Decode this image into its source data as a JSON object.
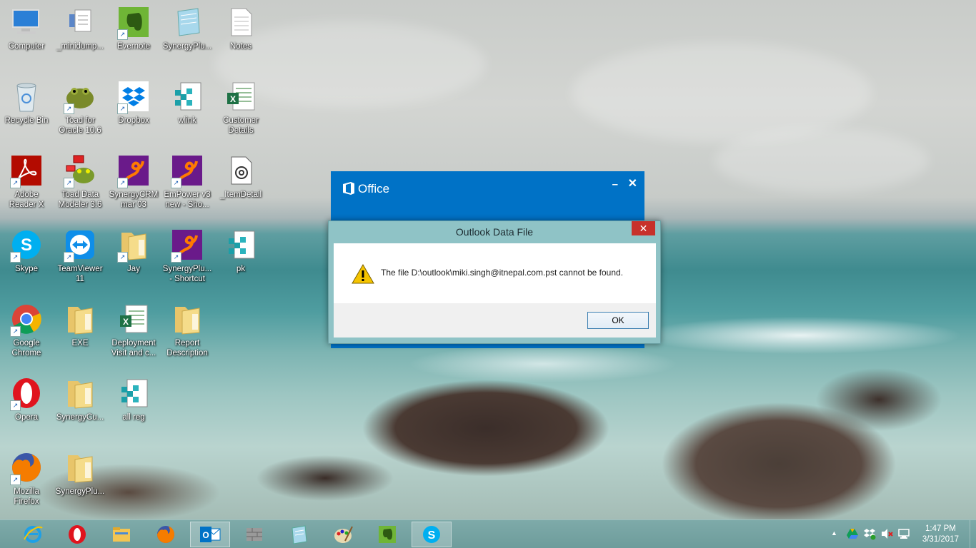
{
  "desktop": {
    "icons": [
      {
        "label": "Computer"
      },
      {
        "label": "_minidump..."
      },
      {
        "label": "Evernote"
      },
      {
        "label": "SynergyPlu..."
      },
      {
        "label": "Notes"
      },
      {
        "label": "Recycle Bin"
      },
      {
        "label": "Toad for Oracle 10.6"
      },
      {
        "label": "Dropbox"
      },
      {
        "label": "wlink"
      },
      {
        "label": "Customer Details"
      },
      {
        "label": "Adobe Reader X"
      },
      {
        "label": "Toad Data Modeler 3.6"
      },
      {
        "label": "SynergyCRM mar 03"
      },
      {
        "label": "EmPower v3 new - Sho..."
      },
      {
        "label": "_ItemDetail"
      },
      {
        "label": "Skype"
      },
      {
        "label": "TeamViewer 11"
      },
      {
        "label": "Jay"
      },
      {
        "label": "SynergyPlu... - Shortcut"
      },
      {
        "label": "pk"
      },
      {
        "label": "Google Chrome"
      },
      {
        "label": "EXE"
      },
      {
        "label": "Deployment Visit and c..."
      },
      {
        "label": "Report Description"
      },
      {
        "label": "Opera"
      },
      {
        "label": "SynergyCu..."
      },
      {
        "label": "all reg"
      },
      {
        "label": "Mozilla Firefox"
      },
      {
        "label": "SynergyPlu..."
      }
    ]
  },
  "office_window": {
    "title": "Office",
    "minimize": "–",
    "close": "✕",
    "accent": "#0072c6"
  },
  "dialog": {
    "title": "Outlook Data File",
    "close": "✕",
    "message": "The file D:\\outlook\\miki.singh@itnepal.com.pst cannot be found.",
    "ok_label": "OK",
    "icon": "warning-icon"
  },
  "taskbar": {
    "apps": [
      {
        "name": "internet-explorer-icon"
      },
      {
        "name": "opera-icon"
      },
      {
        "name": "file-explorer-icon"
      },
      {
        "name": "firefox-icon"
      },
      {
        "name": "outlook-icon",
        "active": true
      },
      {
        "name": "firewall-icon"
      },
      {
        "name": "notepad-icon"
      },
      {
        "name": "paint-icon"
      },
      {
        "name": "evernote-icon"
      },
      {
        "name": "skype-icon",
        "active": true
      }
    ],
    "tray": {
      "overflow": "▲",
      "icons": [
        "google-drive-icon",
        "dropbox-icon",
        "volume-muted-icon",
        "network-icon"
      ]
    },
    "clock": {
      "time": "1:47 PM",
      "date": "3/31/2017"
    }
  }
}
